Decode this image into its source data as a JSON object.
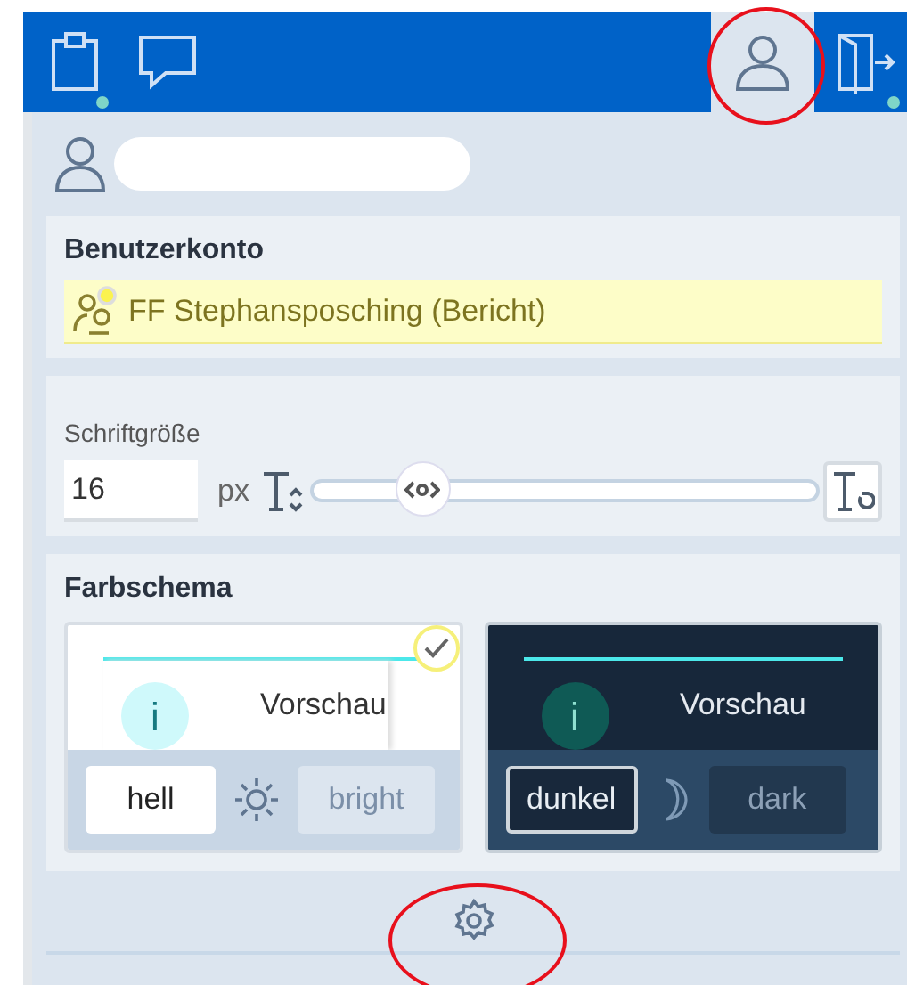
{
  "toolbar": {
    "tabs": [
      {
        "kind": "clipboard",
        "selected": false,
        "dot": true
      },
      {
        "kind": "chat",
        "selected": false,
        "dot": false
      },
      {
        "kind": "user",
        "selected": true,
        "dot": false
      },
      {
        "kind": "logout",
        "selected": false,
        "dot": true
      }
    ]
  },
  "account": {
    "title": "Benutzerkonto",
    "entry": "FF Stephansposching (Bericht)"
  },
  "font_size": {
    "label": "Schriftgröße",
    "value": "16",
    "unit": "px",
    "level": 0.22
  },
  "color_scheme": {
    "title": "Farbschema",
    "themes": [
      {
        "kind": "light",
        "selected": true,
        "preview_label": "Vorschau",
        "preview_icon": "i",
        "name": "hell",
        "alt_name": "bright"
      },
      {
        "kind": "dark",
        "selected": false,
        "preview_label": "Vorschau",
        "preview_icon": "i",
        "name": "dunkel",
        "alt_name": "dark"
      }
    ]
  }
}
